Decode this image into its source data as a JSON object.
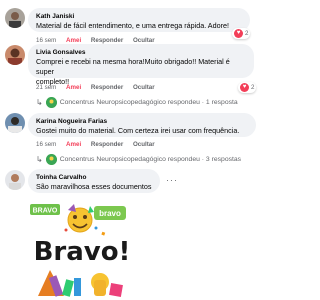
{
  "comments": [
    {
      "author": "Kath Janiski",
      "text": "Material de fácil entendimento, e uma entrega rápida. Adore!",
      "time": "16 sem",
      "love": "Amei",
      "reply": "Responder",
      "hide": "Ocultar",
      "reaction_count": "2"
    },
    {
      "author": "Livia Gonsalves",
      "text_line1": "Comprei e recebi na mesma hora!Muito obrigado!! Material é super",
      "text_line2": "completo!!",
      "time": "21 sem",
      "love": "Amei",
      "reply": "Responder",
      "hide": "Ocultar",
      "reaction_count": "2",
      "replies_text": "Concentrus Neuropsicopedagógico respondeu · 1 resposta"
    },
    {
      "author": "Karina Nogueira Farias",
      "text": "Gostei muito do material. Com certeza irei usar com frequência.",
      "time": "16 sem",
      "love": "Amei",
      "reply": "Responder",
      "hide": "Ocultar",
      "replies_text": "Concentrus Neuropsicopedagógico respondeu · 3 respostas"
    },
    {
      "author": "Toinha Carvalho",
      "text": "São maravilhosa esses documentos"
    }
  ],
  "sticker": {
    "top_label_left": "BRAVO",
    "top_label_right": "bravo",
    "main_word": "Bravo!"
  },
  "colors": {
    "bubble": "#f0f2f5",
    "love": "#f33e58",
    "meta": "#65676b"
  },
  "icons": {
    "heart": "heart-reaction-icon",
    "reply_arrow": "reply-arrow-icon",
    "more": "more-options-icon"
  }
}
